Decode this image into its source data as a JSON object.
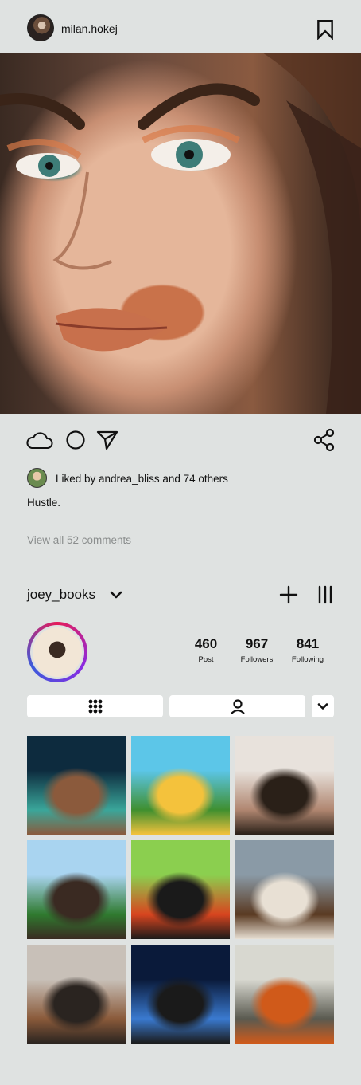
{
  "header": {
    "username": "milan.hokej",
    "avatar_icon": "avatar-photo",
    "bookmark_icon": "bookmark-icon"
  },
  "post": {
    "image_icon": "portrait-photo",
    "actions": [
      "cloud-icon",
      "circle-icon",
      "send-icon"
    ],
    "share_icon": "share-icon",
    "likes_text": "Liked by andrea_bliss and 74 others",
    "caption": "Hustle.",
    "view_comments": "View all 52 comments"
  },
  "profile": {
    "name": "joey_books",
    "stats": [
      {
        "value": "460",
        "label": "Post"
      },
      {
        "value": "967",
        "label": "Followers"
      },
      {
        "value": "841",
        "label": "Following"
      }
    ],
    "ring_colors": [
      "#e51c5a",
      "#8a2be2",
      "#3b5bdb"
    ]
  },
  "tabs": [
    "grid-icon",
    "tagged-user-icon",
    "chevron-down-icon"
  ],
  "grid": [
    {
      "name": "pixel-temple-thumbnail",
      "colors": [
        "#0d2b3e",
        "#3aa69a",
        "#8b5a3c"
      ]
    },
    {
      "name": "platformer-game-thumbnail",
      "colors": [
        "#5cc6e8",
        "#3f8f2f",
        "#f4c23c"
      ]
    },
    {
      "name": "woman-portrait-thumbnail",
      "colors": [
        "#e8e2dc",
        "#b08670",
        "#2a2018"
      ]
    },
    {
      "name": "stadium-thumbnail",
      "colors": [
        "#a9d4f0",
        "#2f7a2f",
        "#3a2a22"
      ]
    },
    {
      "name": "rooster-sunglasses-thumbnail",
      "colors": [
        "#8bcf4f",
        "#d8451f",
        "#1a1a1a"
      ]
    },
    {
      "name": "horse-face-thumbnail",
      "colors": [
        "#8a9aa6",
        "#5a3a22",
        "#e8e0d4"
      ]
    },
    {
      "name": "woman-phone-thumbnail",
      "colors": [
        "#c8c0b8",
        "#8a5a3a",
        "#2a2420"
      ]
    },
    {
      "name": "sports-bar-thumbnail",
      "colors": [
        "#0a1a3a",
        "#3a7ad0",
        "#1a1a1a"
      ]
    },
    {
      "name": "monk-temple-thumbnail",
      "colors": [
        "#d8d8d0",
        "#5a5a50",
        "#d05a1a"
      ]
    }
  ]
}
